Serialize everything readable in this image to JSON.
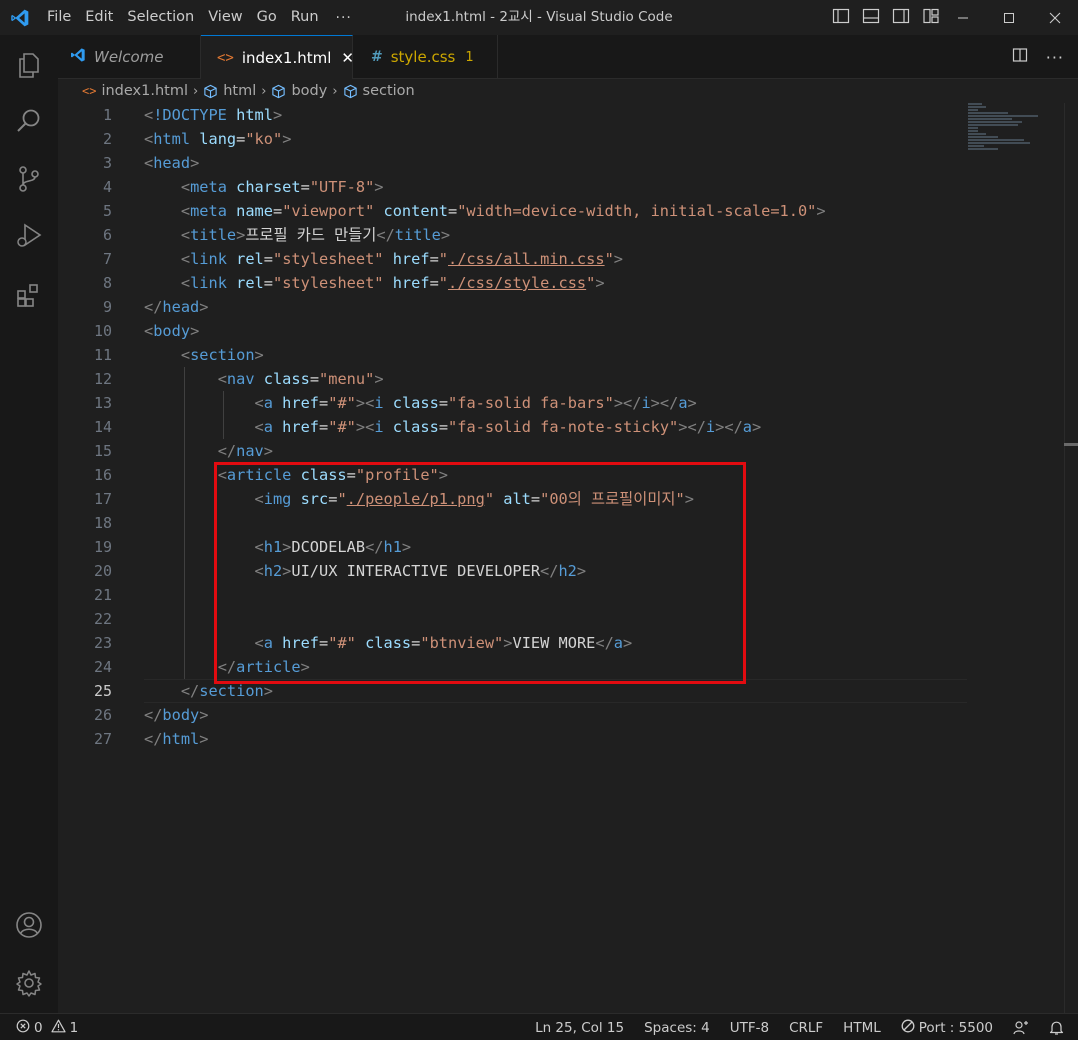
{
  "titlebar": {
    "menu": [
      "File",
      "Edit",
      "Selection",
      "View",
      "Go",
      "Run"
    ],
    "ellipsis": "···",
    "title": "index1.html - 2교시 - Visual Studio Code"
  },
  "tabs": [
    {
      "label": "Welcome",
      "icon": "vscode-icon"
    },
    {
      "label": "index1.html",
      "icon": "html-file-icon",
      "active": true
    },
    {
      "label": "style.css",
      "icon": "css-file-icon",
      "badge": "1"
    }
  ],
  "breadcrumb": [
    "index1.html",
    "html",
    "body",
    "section"
  ],
  "editor": {
    "line_numbers": [
      "1",
      "2",
      "3",
      "4",
      "5",
      "6",
      "7",
      "8",
      "9",
      "10",
      "11",
      "12",
      "13",
      "14",
      "15",
      "16",
      "17",
      "18",
      "19",
      "20",
      "21",
      "22",
      "23",
      "24",
      "25",
      "26",
      "27"
    ],
    "current_line": 25
  },
  "statusbar": {
    "errors": "0",
    "warnings": "1",
    "position": "Ln 25, Col 15",
    "spaces": "Spaces: 4",
    "encoding": "UTF-8",
    "eol": "CRLF",
    "language": "HTML",
    "port": "Port : 5500"
  },
  "colors": {
    "accent": "#0078d4",
    "highlight_box": "#e20b10",
    "tag": "#569cd6",
    "attribute": "#9cdcfe",
    "string": "#ce9178"
  }
}
